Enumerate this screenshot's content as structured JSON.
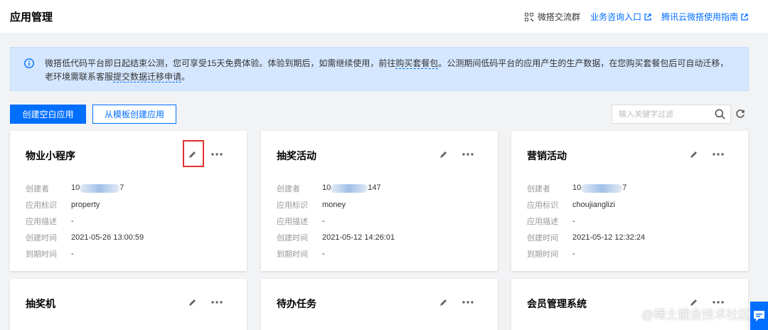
{
  "header": {
    "title": "应用管理",
    "links": [
      {
        "label": "微搭交流群",
        "icon": "qrcode-icon"
      },
      {
        "label": "业务咨询入口",
        "icon": "external-link-icon"
      },
      {
        "label": "腾讯云微搭使用指南",
        "icon": "external-link-icon"
      }
    ]
  },
  "notice": {
    "icon": "info-icon",
    "text_part1": "微搭低代码平台即日起结束公测，您可享受15天免费体验。体验到期后，如需继续使用，前往",
    "link_buy": "购买套餐包",
    "text_part2": "。公测期间低码平台的应用产生的生产数据，在您购买套餐包后可自动迁移，老环境需联系客服",
    "link_migrate": "提交数据迁移申请",
    "text_part3": "。"
  },
  "toolbar": {
    "create_blank_label": "创建空白应用",
    "create_template_label": "从模板创建应用",
    "search_placeholder": "输入关键字过滤"
  },
  "field_labels": {
    "creator": "创建者",
    "app_id": "应用标识",
    "app_desc": "应用描述",
    "created_at": "创建时间",
    "expire_at": "到期时间"
  },
  "cards": [
    {
      "title": "物业小程序",
      "creator_prefix": "10",
      "creator_suffix": "7",
      "app_id": "property",
      "app_desc": "-",
      "created_at": "2021-05-26 13:00:59",
      "expire_at": "-"
    },
    {
      "title": "抽奖活动",
      "creator_prefix": "10",
      "creator_suffix": "147",
      "app_id": "money",
      "app_desc": "-",
      "created_at": "2021-05-12 14:26:01",
      "expire_at": "-"
    },
    {
      "title": "营销活动",
      "creator_prefix": "10",
      "creator_suffix": "7",
      "app_id": "choujianglizi",
      "app_desc": "-",
      "created_at": "2021-05-12 12:32:24",
      "expire_at": "-"
    },
    {
      "title": "抽奖机"
    },
    {
      "title": "待办任务"
    },
    {
      "title": "会员管理系统"
    }
  ],
  "watermark": "@稀土掘金技术社区",
  "colors": {
    "accent": "#006eff",
    "highlight_border": "#e0332f",
    "notice_bg": "#d5e7ff"
  }
}
